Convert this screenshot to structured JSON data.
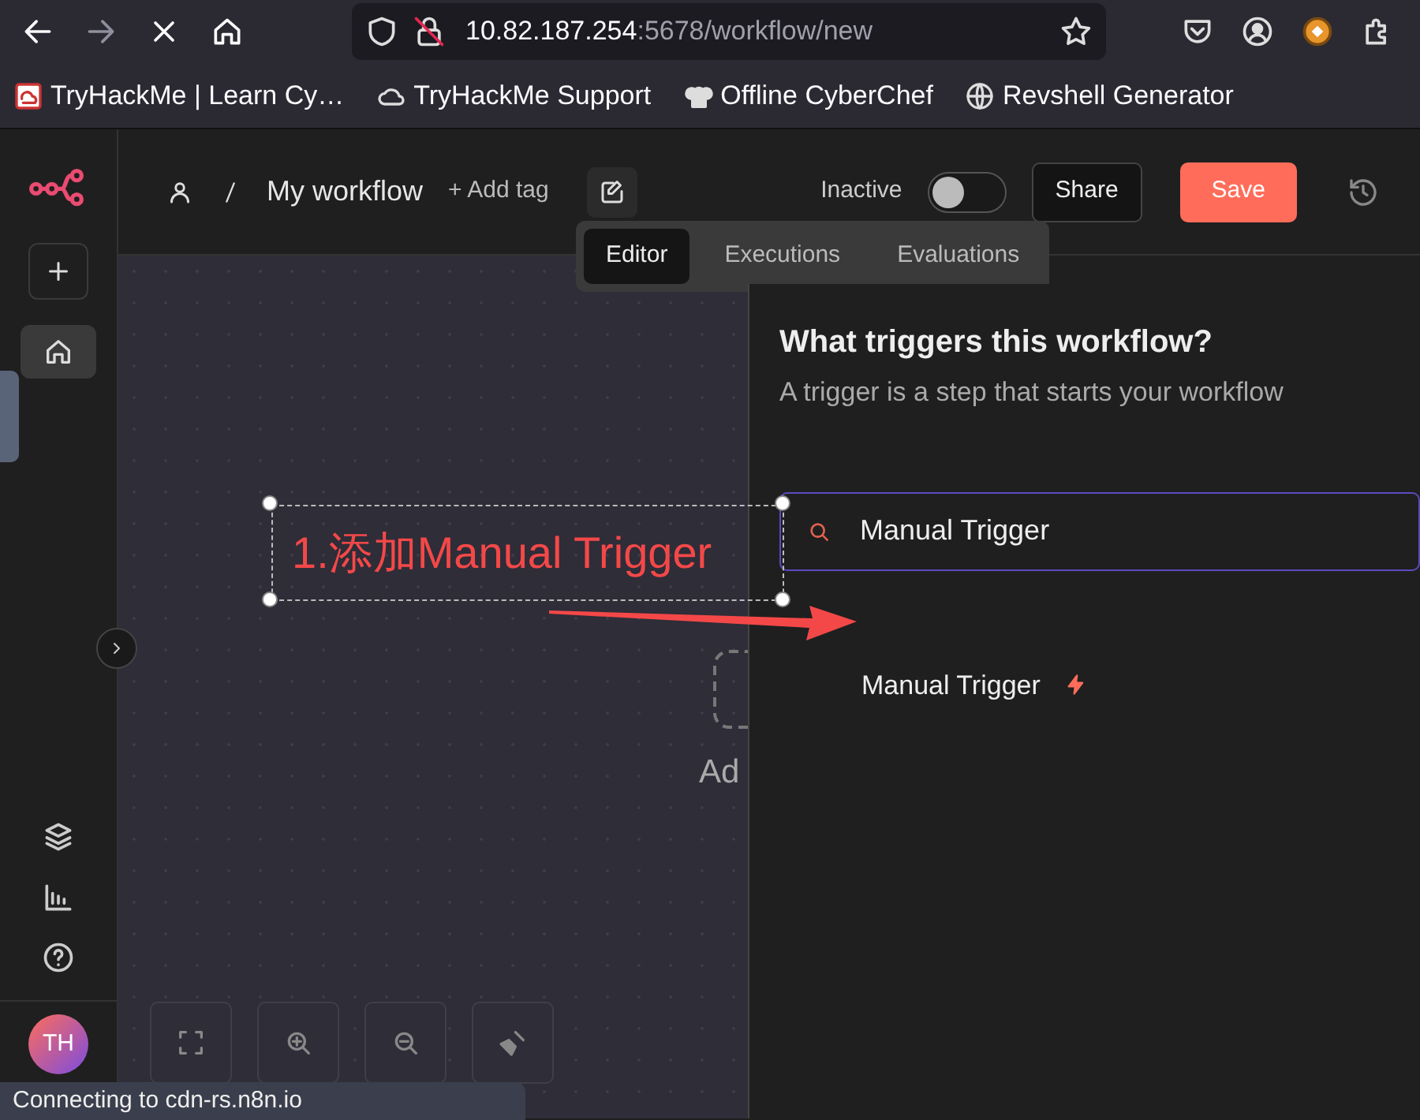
{
  "browser": {
    "nav_buttons": [
      {
        "kind": "back",
        "disabled": false
      },
      {
        "kind": "forward",
        "disabled": true
      },
      {
        "kind": "stop",
        "disabled": false
      },
      {
        "kind": "home",
        "disabled": false
      }
    ],
    "url": {
      "host": "10.82.187.254",
      "path": ":5678/workflow/new"
    },
    "bookmarks": [
      {
        "kind": "thm",
        "label": "TryHackMe | Learn Cy…"
      },
      {
        "kind": "cloud",
        "label": "TryHackMe Support"
      },
      {
        "kind": "chef",
        "label": "Offline CyberChef"
      },
      {
        "kind": "globe",
        "label": "Revshell Generator"
      }
    ]
  },
  "sidebar": {
    "avatar": "TH"
  },
  "header": {
    "workflow_name": "My workflow",
    "add_tag": "+ Add tag",
    "status_label": "Inactive",
    "toggle": {
      "on": false
    },
    "share": "Share",
    "save": "Save"
  },
  "tabs": [
    {
      "label": "Editor",
      "selected": true
    },
    {
      "label": "Executions",
      "selected": false
    },
    {
      "label": "Evaluations",
      "selected": false
    }
  ],
  "canvas": {
    "add_node_label": "Ad"
  },
  "panel": {
    "title": "What triggers this workflow?",
    "subtitle": "A trigger is a step that starts your workflow",
    "search": {
      "value": "Manual Trigger"
    },
    "results": [
      {
        "label": "Manual Trigger"
      }
    ]
  },
  "annotation": {
    "text": "1.添加Manual Trigger"
  },
  "status_tooltip": "Connecting to cdn-rs.n8n.io"
}
